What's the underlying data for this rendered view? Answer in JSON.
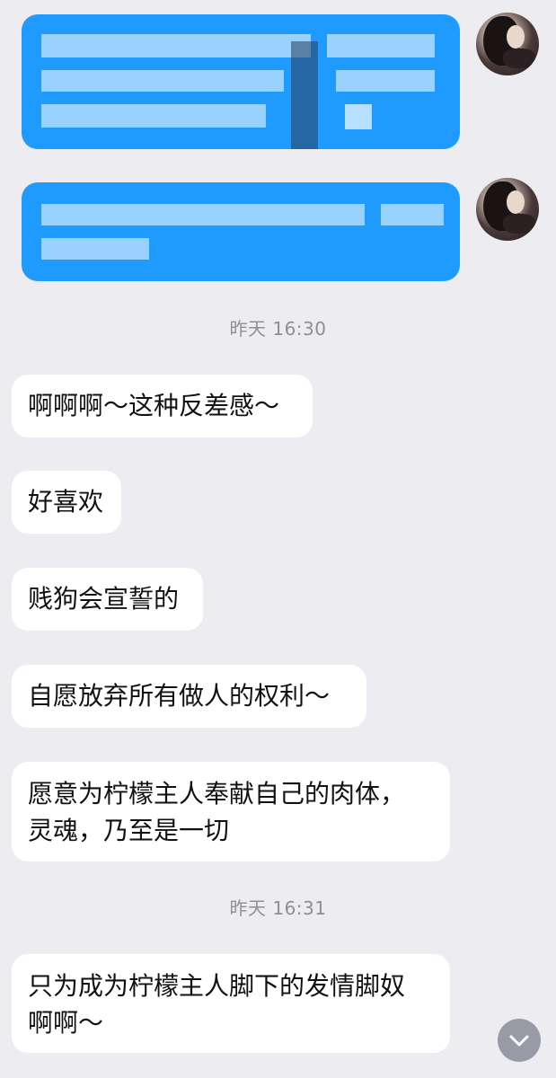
{
  "messages": {
    "timestamp_1": "昨天 16:30",
    "msg_1": "啊啊啊～这种反差感～",
    "msg_2": "好喜欢",
    "msg_3": "贱狗会宣誓的",
    "msg_4": "自愿放弃所有做人的权利～",
    "msg_5": "愿意为柠檬主人奉献自己的肉体，\n灵魂，乃至是一切",
    "timestamp_2": "昨天 16:31",
    "msg_6": "只为成为柠檬主人脚下的发情脚奴\n啊啊～"
  },
  "colors": {
    "outgoing_bubble": "#1f9bff",
    "incoming_bubble": "#ffffff",
    "background": "#ececf1"
  },
  "icons": {
    "scroll_down": "chevron-down-icon"
  }
}
